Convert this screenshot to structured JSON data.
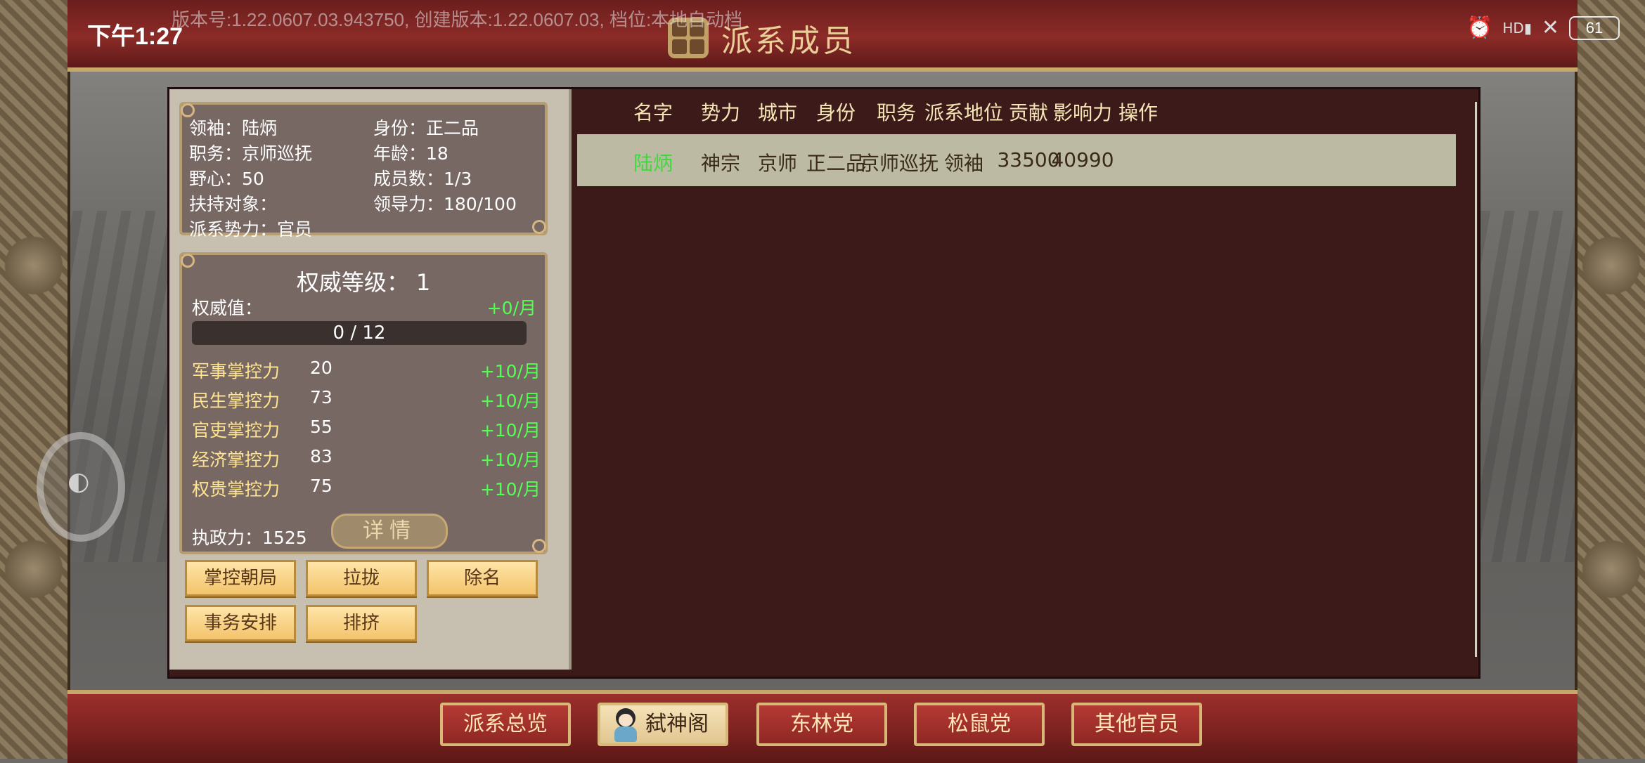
{
  "status_bar": {
    "time": "下午1:27",
    "version": "版本号:1.22.0607.03.943750, 创建版本:1.22.0607.03, 档位:本地自动档",
    "hd_label": "HD",
    "battery": "61",
    "icons": [
      "alarm-icon",
      "signal-icon",
      "wifi-icon",
      "battery-icon"
    ]
  },
  "header": {
    "title": "派系成员"
  },
  "leader_info": {
    "leader": "领袖：陆炳",
    "rank": "身份：正二品",
    "duty": "职务：京师巡抚",
    "age": "年龄：18",
    "ambition": "野心：50",
    "members": "成员数：1/3",
    "support_target": "扶持对象：",
    "leadership": "领导力：180/100",
    "faction_power": "派系势力：官员"
  },
  "authority": {
    "title": "权威等级：",
    "level": "1",
    "value_label": "权威值：",
    "rate": "+0/月",
    "progress_text": "0 / 12",
    "progress_fraction": 0.0,
    "controls": [
      {
        "name": "军事掌控力",
        "value": "20",
        "rate": "+10/月"
      },
      {
        "name": "民生掌控力",
        "value": "73",
        "rate": "+10/月"
      },
      {
        "name": "官吏掌控力",
        "value": "55",
        "rate": "+10/月"
      },
      {
        "name": "经济掌控力",
        "value": "83",
        "rate": "+10/月"
      },
      {
        "name": "权贵掌控力",
        "value": "75",
        "rate": "+10/月"
      }
    ],
    "exec_label": "执政力：",
    "exec_value": "1525",
    "detail_button": "详情"
  },
  "actions": {
    "control_court": "掌控朝局",
    "recruit": "拉拢",
    "expel": "除名",
    "arrange_affairs": "事务安排",
    "exclude": "排挤"
  },
  "table": {
    "headers": [
      "名字",
      "势力",
      "城市",
      "身份",
      "职务",
      "派系地位",
      "贡献",
      "影响力",
      "操作"
    ],
    "rows": [
      [
        "陆炳",
        "神宗",
        "京师",
        "正二品",
        "京师巡抚",
        "领袖",
        "33500",
        "40990",
        ""
      ]
    ]
  },
  "bottom_tabs": [
    "派系总览",
    "弑神阁",
    "东林党",
    "松鼠党",
    "其他官员"
  ],
  "colors": {
    "panel_bg": "#3d1a1a",
    "left_panel_bg": "#c7c0b0",
    "card_bg": "#786864",
    "accent_gold": "#c9a76a",
    "rate_green": "#53ff53",
    "name_green": "#3ed93e",
    "control_label_yellow": "#ffe58e"
  }
}
